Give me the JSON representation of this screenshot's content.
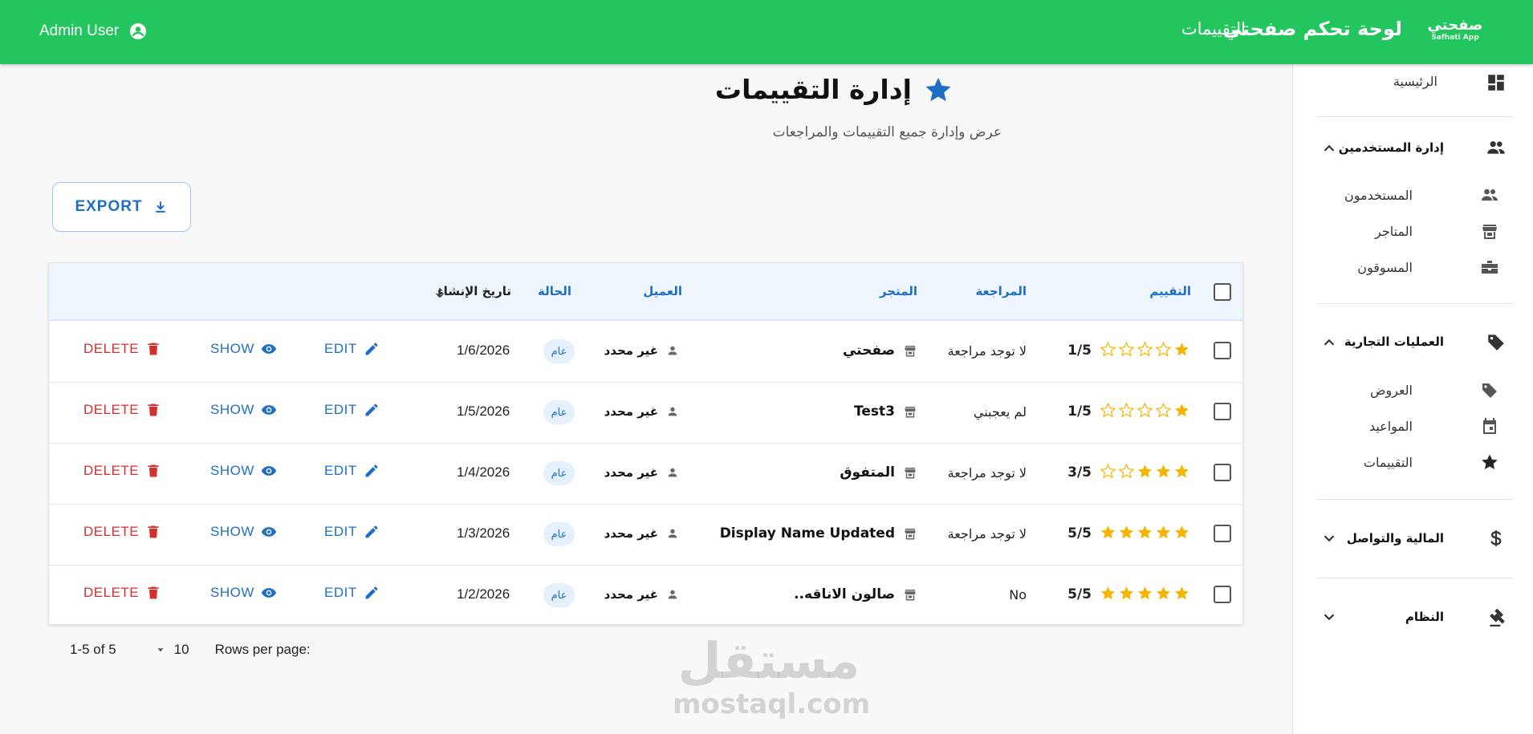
{
  "topbar": {
    "user_name": "Admin User",
    "nav_title": "لوحة تحكم صفحتي",
    "nav_reviews": "التقييمات",
    "logo_main": "صفحتي",
    "logo_sub": "Safhati App"
  },
  "page": {
    "title": "إدارة التقييمات",
    "subtitle": "عرض وإدارة جميع التقييمات والمراجعات",
    "export_label": "EXPORT"
  },
  "table": {
    "headers": {
      "rating": "التقييم",
      "review": "المراجعة",
      "store": "المتجر",
      "client": "العميل",
      "status": "الحالة",
      "created": "تاريخ الإنشاء"
    },
    "rows": [
      {
        "stars": 1,
        "rating": "1/5",
        "review": "لا توجد مراجعة",
        "store": "صفحتي",
        "client": "غير محدد",
        "status": "عام",
        "date": "1/6/2026"
      },
      {
        "stars": 1,
        "rating": "1/5",
        "review": "لم يعجبني",
        "store": "Test3",
        "client": "غير محدد",
        "status": "عام",
        "date": "1/5/2026"
      },
      {
        "stars": 3,
        "rating": "3/5",
        "review": "لا توجد مراجعة",
        "store": "المتفوق",
        "client": "غير محدد",
        "status": "عام",
        "date": "1/4/2026"
      },
      {
        "stars": 5,
        "rating": "5/5",
        "review": "لا توجد مراجعة",
        "store": "Display Name Updated",
        "client": "غير محدد",
        "status": "عام",
        "date": "1/3/2026"
      },
      {
        "stars": 5,
        "rating": "5/5",
        "review": "No",
        "store": "صالون الاناقه..",
        "client": "غير محدد",
        "status": "عام",
        "date": "1/2/2026"
      }
    ],
    "actions": {
      "edit": "EDIT",
      "show": "SHOW",
      "delete": "DELETE"
    }
  },
  "pagination": {
    "range": "1-5 of 5",
    "rows_per_page_label": "Rows per page:",
    "rows_per_page_value": "10"
  },
  "watermark": {
    "arabic": "مستقل",
    "latin": "mostaql.com"
  },
  "sidebar": {
    "home": "الرئيسية",
    "users_group": "إدارة المستخدمين",
    "users": "المستخدمون",
    "stores": "المتاجر",
    "marketers": "المسوقون",
    "business_group": "العمليات التجارية",
    "offers": "العروض",
    "appointments": "المواعيد",
    "reviews": "التقييمات",
    "finance_group": "المالية والتواصل",
    "system_group": "النظام"
  },
  "colors": {
    "topbar": "#22c55e",
    "primary": "#1e6fc4",
    "danger": "#d32f2f",
    "star": "#f5b400"
  }
}
